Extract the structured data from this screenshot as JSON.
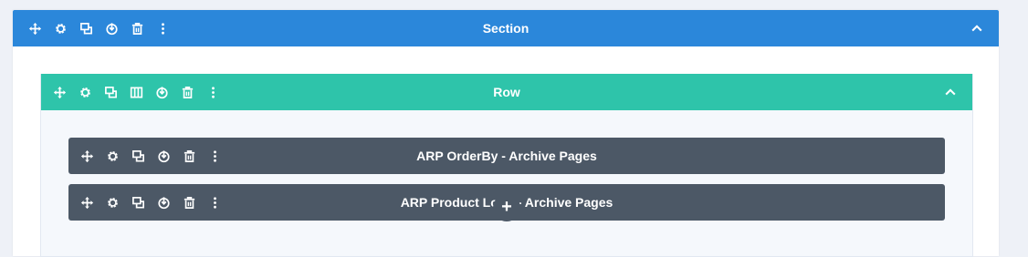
{
  "section": {
    "title": "Section",
    "toolbar": [
      "move-icon",
      "settings-icon",
      "duplicate-icon",
      "save-icon",
      "delete-icon",
      "more-icon"
    ],
    "color": "#2b87da"
  },
  "row": {
    "title": "Row",
    "toolbar": [
      "move-icon",
      "settings-icon",
      "duplicate-icon",
      "columns-icon",
      "save-icon",
      "delete-icon",
      "more-icon"
    ],
    "color": "#2ec4aa"
  },
  "modules": [
    {
      "title": "ARP OrderBy - Archive Pages"
    },
    {
      "title": "ARP Product Loop - Archive Pages"
    }
  ],
  "module_color": "#4c5866",
  "add_module_label": "+"
}
